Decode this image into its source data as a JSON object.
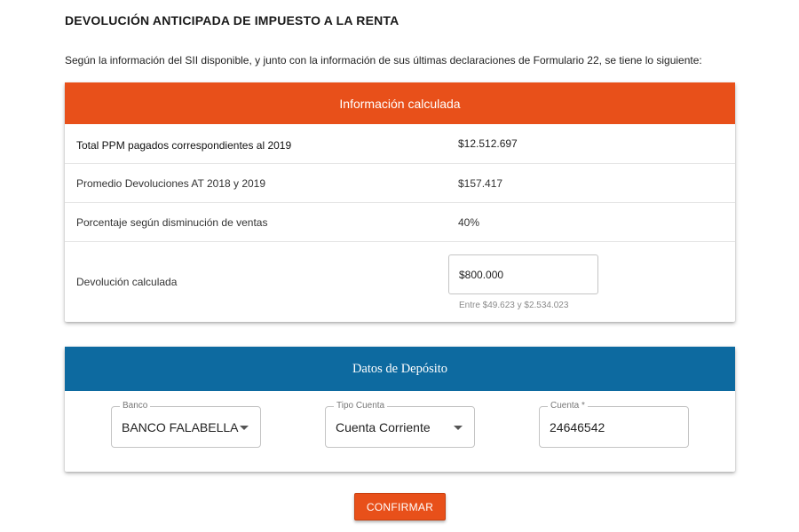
{
  "page": {
    "title": "DEVOLUCIÓN ANTICIPADA DE IMPUESTO A LA RENTA",
    "intro": "Según la información del SII disponible, y junto con la información de sus últimas declaraciones de Formulario 22, se tiene lo siguiente:"
  },
  "info_card": {
    "header": "Información calculada",
    "header_color": "#e8501a",
    "rows": [
      {
        "label": "Total PPM pagados correspondientes al 2019",
        "value": "$12.512.697"
      },
      {
        "label": "Promedio Devoluciones AT 2018 y 2019",
        "value": "$157.417"
      },
      {
        "label": "Porcentaje según disminución de ventas",
        "value": "40%"
      }
    ],
    "calculated": {
      "label": "Devolución calculada",
      "value": "$800.000",
      "helper": "Entre $49.623 y $2.534.023"
    }
  },
  "deposit_card": {
    "header": "Datos de Depósito",
    "header_color": "#0d6aa0",
    "bank": {
      "label": "Banco",
      "value": "BANCO FALABELLA",
      "icon": "caret-down-icon"
    },
    "account_type": {
      "label": "Tipo Cuenta",
      "value": "Cuenta Corriente",
      "icon": "caret-down-icon"
    },
    "account": {
      "label": "Cuenta *",
      "value": "24646542"
    }
  },
  "actions": {
    "confirm_label": "CONFIRMAR"
  }
}
